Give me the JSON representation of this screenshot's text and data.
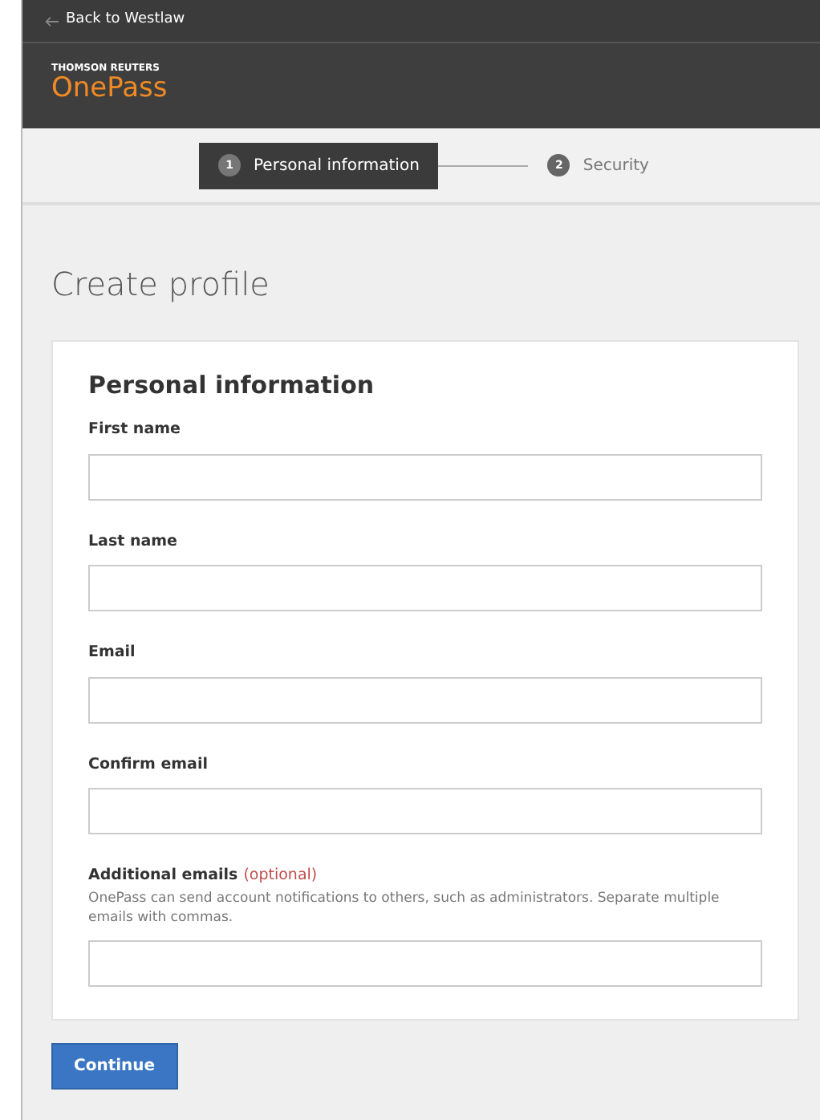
{
  "topbar": {
    "back_link": "Back to Westlaw"
  },
  "brand": {
    "company": "THOMSON REUTERS",
    "product": "OnePass"
  },
  "steps": [
    {
      "number": "1",
      "label": "Personal information",
      "selected": true
    },
    {
      "number": "2",
      "label": "Security",
      "selected": false
    }
  ],
  "page_title": "Create profile",
  "form": {
    "heading": "Personal information",
    "fields": [
      {
        "label": "First name"
      },
      {
        "label": "Last name"
      },
      {
        "label": "Email"
      },
      {
        "label": "Confirm email"
      },
      {
        "label": "Additional emails",
        "optional": "(optional)",
        "hint": "OnePass can send account notifications to others, such as administrators. Separate multiple emails with commas."
      }
    ]
  },
  "buttons": [
    "Continue"
  ]
}
